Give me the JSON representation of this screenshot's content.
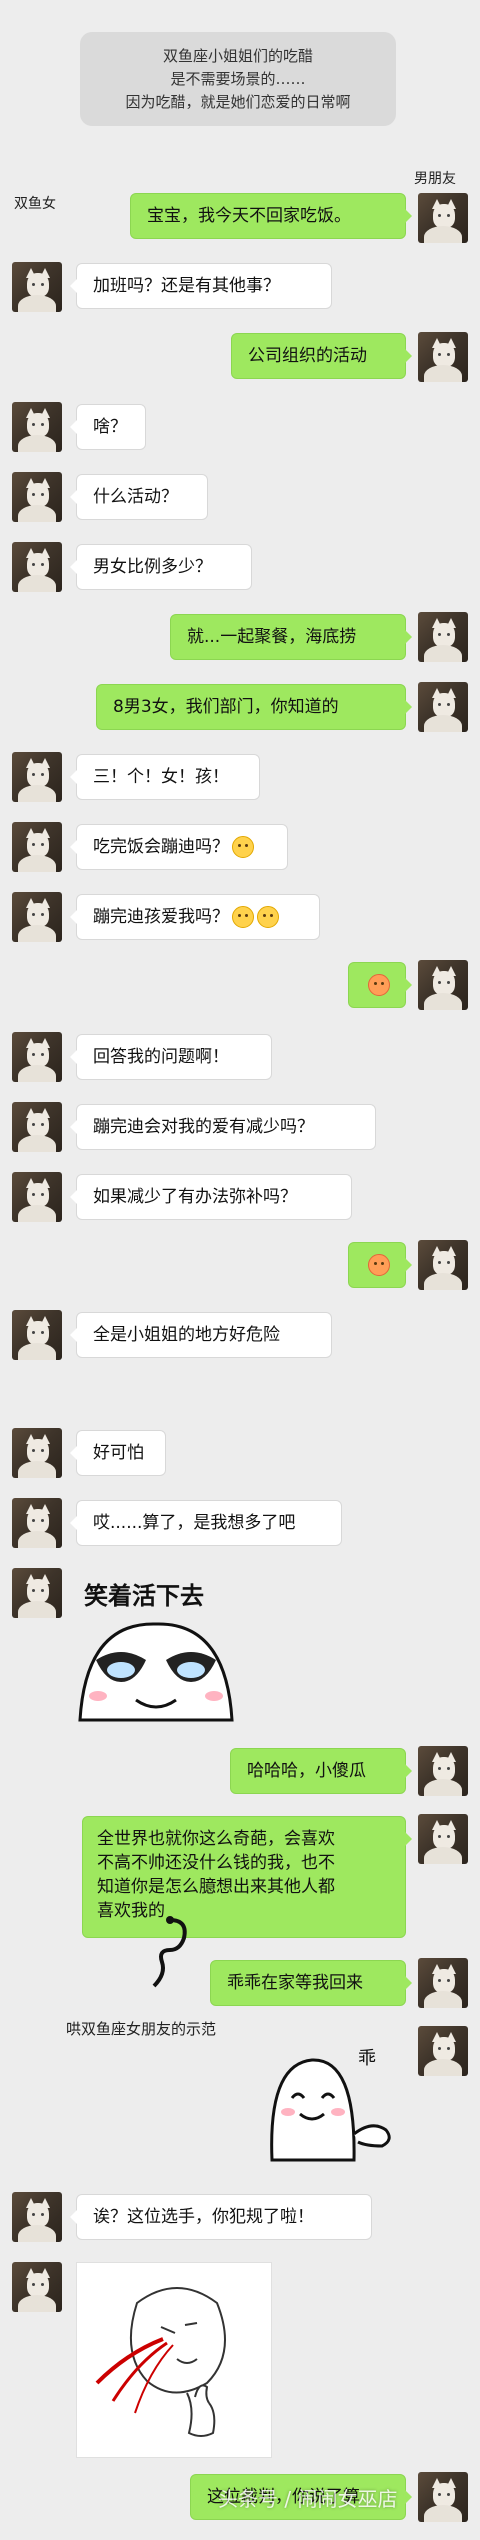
{
  "notice": {
    "line1": "双鱼座小姐姐们的吃醋",
    "line2": "是不需要场景的……",
    "line3": "因为吃醋，就是她们恋爱的日常啊"
  },
  "names": {
    "boyfriend": "男朋友",
    "girlfriend": "双鱼女"
  },
  "messages": {
    "m1": "宝宝，我今天不回家吃饭。",
    "m2": "加班吗？还是有其他事？",
    "m3": "公司组织的活动",
    "m4": "啥？",
    "m5": "什么活动？",
    "m6": "男女比例多少？",
    "m7": "就...一起聚餐，海底捞",
    "m8": "8男3女，我们部门，你知道的",
    "m9": "三！个！女！孩！",
    "m10": "吃完饭会蹦迪吗？",
    "m11": "蹦完迪孩爱我吗？",
    "m13": "回答我的问题啊！",
    "m14": "蹦完迪会对我的爱有减少吗？",
    "m15": "如果减少了有办法弥补吗？",
    "m17": "全是小姐姐的地方好危险",
    "m18": "好可怕",
    "m19": "哎......算了，是我想多了吧",
    "m21": "哈哈哈，小傻瓜",
    "m22a": "全世界也就你这么奇葩，会喜欢",
    "m22b": "不高不帅还没什么钱的我，也不",
    "m22c": "知道你是怎么臆想出来其他人都",
    "m22d": "喜欢我的",
    "m23": "乖乖在家等我回来",
    "m25": "诶？这位选手，你犯规了啦！",
    "m27": "这位裁判，你说了算"
  },
  "stickers": {
    "smile_live": "笑着活下去",
    "caption": "哄双鱼座女朋友的示范",
    "guai": "乖"
  },
  "watermark": "头条号 / 闹闹女巫店",
  "colors": {
    "background": "#ededed",
    "green_bubble": "#9ee85f",
    "white_bubble": "#ffffff"
  }
}
